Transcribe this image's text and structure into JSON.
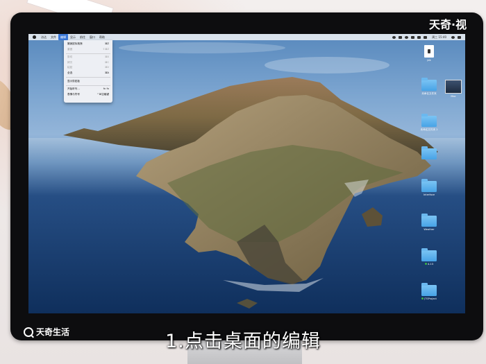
{
  "menubar": {
    "items": [
      "访达",
      "文件",
      "编辑",
      "显示",
      "前往",
      "窗口",
      "帮助"
    ],
    "active_index": 2,
    "clock": "周三 15:40"
  },
  "edit_menu": {
    "items": [
      {
        "label": "撤销鼠标拖拽",
        "shortcut": "⌘Z",
        "disabled": false
      },
      {
        "label": "重做",
        "shortcut": "⇧⌘Z",
        "disabled": true
      },
      {
        "sep": true
      },
      {
        "label": "剪切",
        "shortcut": "⌘X",
        "disabled": true
      },
      {
        "label": "拷贝",
        "shortcut": "⌘C",
        "disabled": true
      },
      {
        "label": "粘贴",
        "shortcut": "⌘V",
        "disabled": true
      },
      {
        "label": "全选",
        "shortcut": "⌘A",
        "disabled": false
      },
      {
        "sep": true
      },
      {
        "label": "显示剪贴板",
        "shortcut": "",
        "disabled": false
      },
      {
        "sep": true
      },
      {
        "label": "开始听写...",
        "shortcut": "fn fn",
        "disabled": false
      },
      {
        "label": "表情与符号",
        "shortcut": "^⌘空格键",
        "disabled": false
      }
    ]
  },
  "desktop_icons": [
    {
      "label": "jdk",
      "kind": "doc"
    },
    {
      "label": "Mac",
      "kind": "thumb"
    },
    {
      "label": "未命名文件夹",
      "kind": "folder"
    },
    {
      "label": "未命名文件夹 2",
      "kind": "folder"
    },
    {
      "label": "",
      "kind": "folder"
    },
    {
      "label": "Interface",
      "kind": "folder"
    },
    {
      "label": "Weather",
      "kind": "folder"
    },
    {
      "label": "4.13",
      "kind": "folder",
      "tag": true
    },
    {
      "label": "JTSProject",
      "kind": "folder",
      "tag": true
    }
  ],
  "watermark": "天奇·视",
  "brand": "天奇生活",
  "subtitle": "1.点击桌面的编辑"
}
